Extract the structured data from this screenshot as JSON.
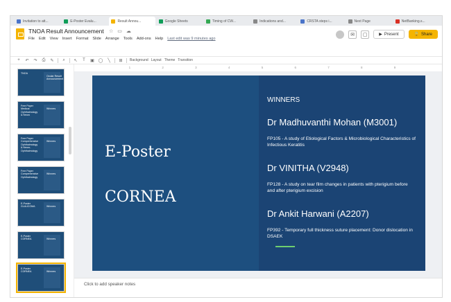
{
  "browser": {
    "tabs": [
      {
        "label": "Invitation to att...",
        "color": "#4a74c9"
      },
      {
        "label": "E-Poster Evalu...",
        "color": "#0f9d58"
      },
      {
        "label": "Result Annou...",
        "color": "#f4b400",
        "active": true
      },
      {
        "label": "Google Sheets",
        "color": "#0f9d58"
      },
      {
        "label": "Timing of CW...",
        "color": "#34a853"
      },
      {
        "label": "Indications and...",
        "color": "#888888"
      },
      {
        "label": "CRSTA steps i...",
        "color": "#4a74c9"
      },
      {
        "label": "Next Page",
        "color": "#888888"
      },
      {
        "label": "NetBanking.s...",
        "color": "#d93025"
      }
    ]
  },
  "app": {
    "doc_title": "TNOA Result Announcement",
    "title_icons": [
      "star-icon",
      "folder-icon",
      "cloud-icon"
    ],
    "menu": [
      "File",
      "Edit",
      "View",
      "Insert",
      "Format",
      "Slide",
      "Arrange",
      "Tools",
      "Add-ons",
      "Help"
    ],
    "last_edit": "Last edit was 9 minutes ago",
    "present_label": "Present",
    "share_label": "Share",
    "share_color": "#f4b400"
  },
  "toolbar": {
    "background_label": "Background",
    "layout_label": "Layout",
    "theme_label": "Theme",
    "transition_label": "Transition"
  },
  "ruler": [
    "1",
    "2",
    "3",
    "4",
    "5",
    "6",
    "7",
    "8",
    "9"
  ],
  "filmstrip": {
    "slides": [
      {
        "left": "TNOA",
        "right": "Ocular Result Announcement"
      },
      {
        "left": "Free Paper\nMedical\nOphthalmology\n& Neuro",
        "right": "Winners"
      },
      {
        "left": "Free Paper\nComprehensive\nOphthalmology\n& Neuro-\nOphthalmology",
        "right": "Winners"
      },
      {
        "left": "Free Paper\nComprehensive\nOphthalmology",
        "right": "Winners"
      },
      {
        "left": "E-Poster\nGLAUCOMA",
        "right": "Winners"
      },
      {
        "left": "E-Poster\nCORNEA",
        "right": "Winners"
      },
      {
        "left": "E-Poster\nCORNEA",
        "right": "Winners",
        "selected": true
      }
    ]
  },
  "slide": {
    "left_title_1": "E-Poster",
    "left_title_2": "CORNEA",
    "winners_heading": "WINNERS",
    "winners": [
      {
        "name": "Dr Madhuvanthi Mohan (M3001)",
        "desc": "FP105 - A study of Etiological Factors & Microbiological Characteristics of Infectious Keratitis"
      },
      {
        "name": "Dr VINITHA (V2948)",
        "desc": "FP128 - A study on tear film changes in patients with pterigium before and after pterigium excision"
      },
      {
        "name": "Dr Ankit Harwani (A2207)",
        "desc": "FP392 - Temporary full thickness suture placement: Donor dislocation in DSAEK"
      }
    ],
    "colors": {
      "left_panel": "#1d4f7f",
      "right_panel": "#1b4474",
      "accent": "#6fcf6f"
    }
  },
  "notes": {
    "placeholder": "Click to add speaker notes"
  }
}
